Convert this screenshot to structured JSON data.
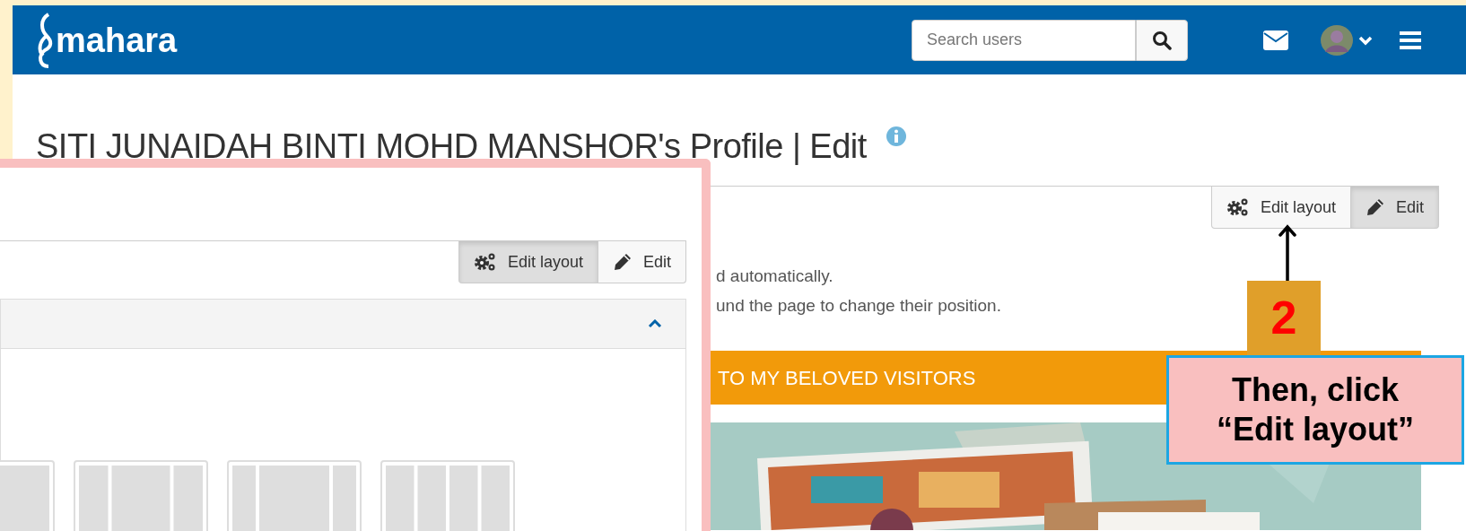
{
  "navbar": {
    "logo": "mahara",
    "search": {
      "placeholder": "Search users"
    }
  },
  "page": {
    "title": "SITI JUNAIDAH BINTI MOHD MANSHOR's Profile | Edit",
    "buttons": [
      {
        "label": "Edit layout",
        "kind": "gears",
        "selected": false
      },
      {
        "label": "Edit",
        "kind": "pencil",
        "selected": true
      }
    ],
    "instructions": [
      "d automatically.",
      "und the page to change their position."
    ],
    "block_title": "TO MY BELOVED VISITORS"
  },
  "zoom_inset": {
    "buttons": [
      {
        "label": "Edit layout",
        "kind": "gears",
        "selected": true
      },
      {
        "label": "Edit",
        "kind": "pencil",
        "selected": false
      }
    ],
    "panel": {
      "expanded": true
    }
  },
  "annotation": {
    "step": "2",
    "callout": "Then, click “Edit layout”"
  }
}
